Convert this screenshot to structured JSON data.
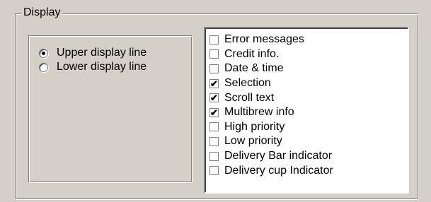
{
  "group": {
    "title": "Display"
  },
  "radios": [
    {
      "label": "Upper display line",
      "checked": true
    },
    {
      "label": "Lower display line",
      "checked": false
    }
  ],
  "checklist": [
    {
      "label": "Error messages",
      "checked": false
    },
    {
      "label": "Credit info.",
      "checked": false
    },
    {
      "label": "Date & time",
      "checked": false
    },
    {
      "label": "Selection",
      "checked": true
    },
    {
      "label": "Scroll text",
      "checked": true
    },
    {
      "label": "Multibrew info",
      "checked": true
    },
    {
      "label": "High priority",
      "checked": false
    },
    {
      "label": "Low priority",
      "checked": false
    },
    {
      "label": "Delivery Bar indicator",
      "checked": false
    },
    {
      "label": "Delivery cup Indicator",
      "checked": false
    }
  ]
}
